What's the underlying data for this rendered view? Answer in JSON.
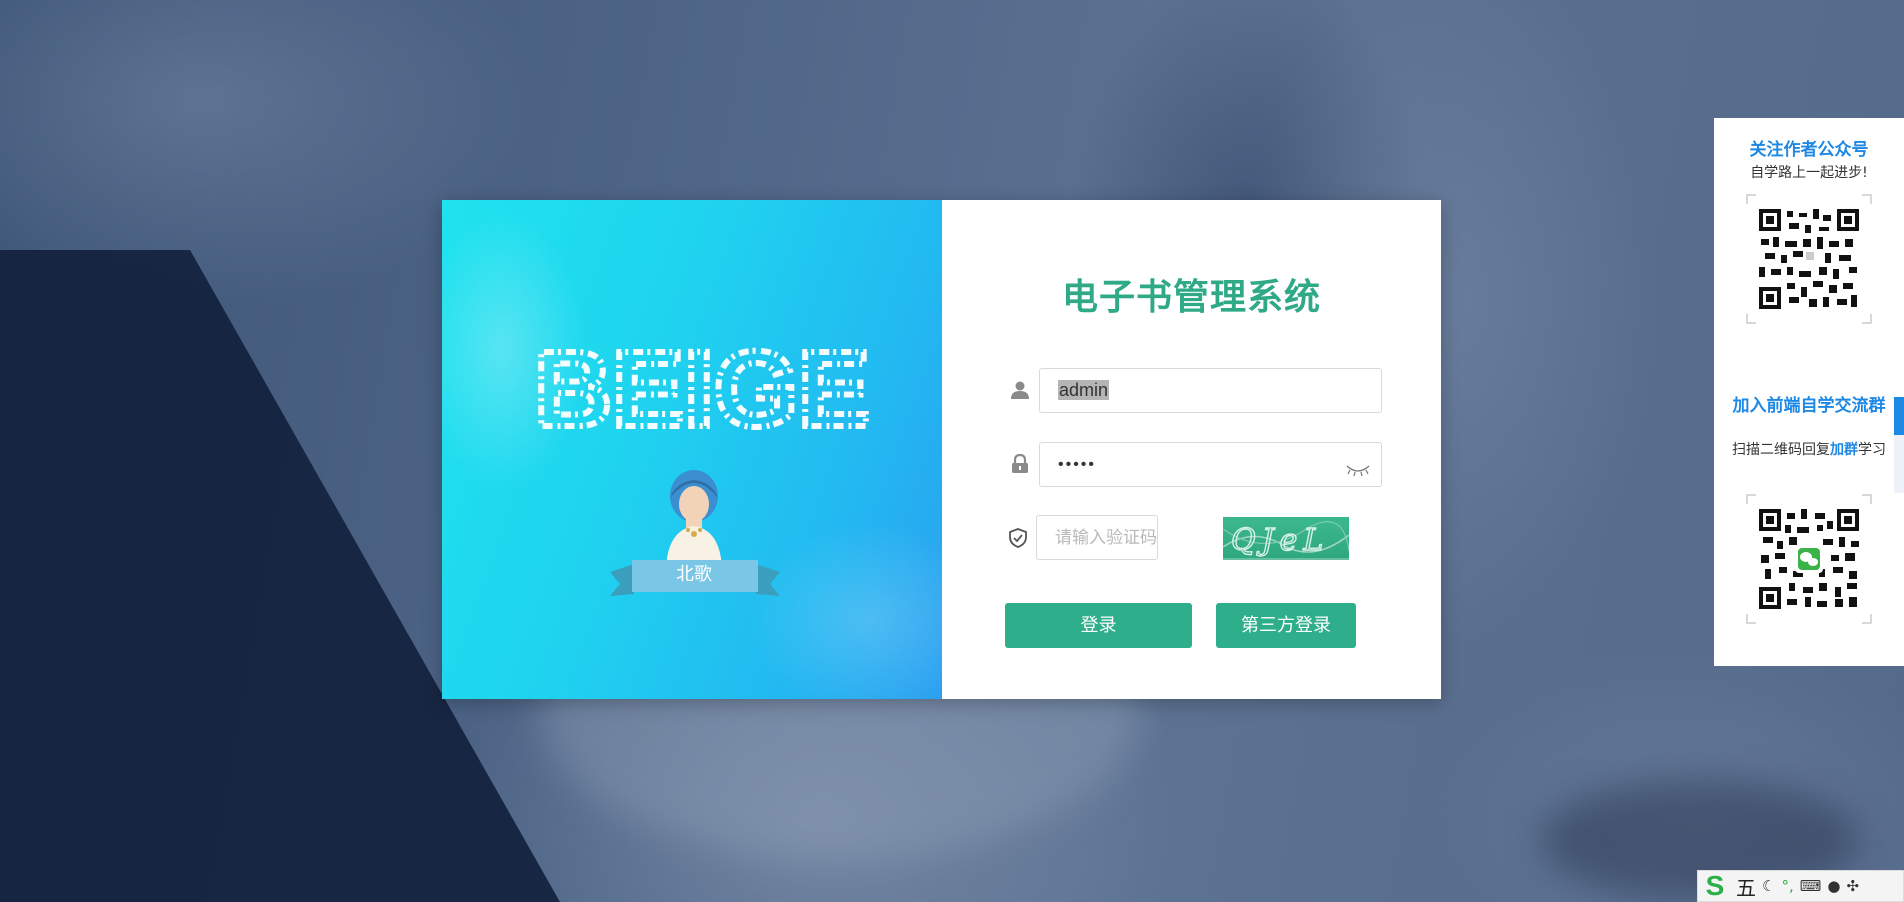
{
  "login_card": {
    "banner": {
      "logo_text": "BEIGE",
      "ribbon_text": "北歌"
    },
    "title": "电子书管理系统",
    "username": {
      "value": "admin"
    },
    "password": {
      "masked_value": "•••••"
    },
    "captcha": {
      "placeholder": "请输入验证码",
      "image_text": "QJeL"
    },
    "buttons": {
      "login": "登录",
      "third_party_login": "第三方登录"
    },
    "icons": {
      "user": "user-icon",
      "lock": "lock-icon",
      "shield": "shield-icon",
      "eye": "eye-closed-icon"
    },
    "accent_color": "#2fae8b"
  },
  "side_panel": {
    "section1": {
      "title": "关注作者公众号",
      "subtitle": "自学路上一起进步!"
    },
    "section2": {
      "title": "加入前端自学交流群",
      "subtitle_prefix": "扫描二维码回复",
      "subtitle_highlight": "加群",
      "subtitle_suffix": "学习"
    },
    "accent_color": "#1e88e5"
  },
  "ime_toolbar": {
    "mode": "五",
    "icons": [
      "sogou-s-icon",
      "moon-icon",
      "punctuation-icon",
      "keyboard-icon",
      "user-icon",
      "grid-icon"
    ]
  }
}
